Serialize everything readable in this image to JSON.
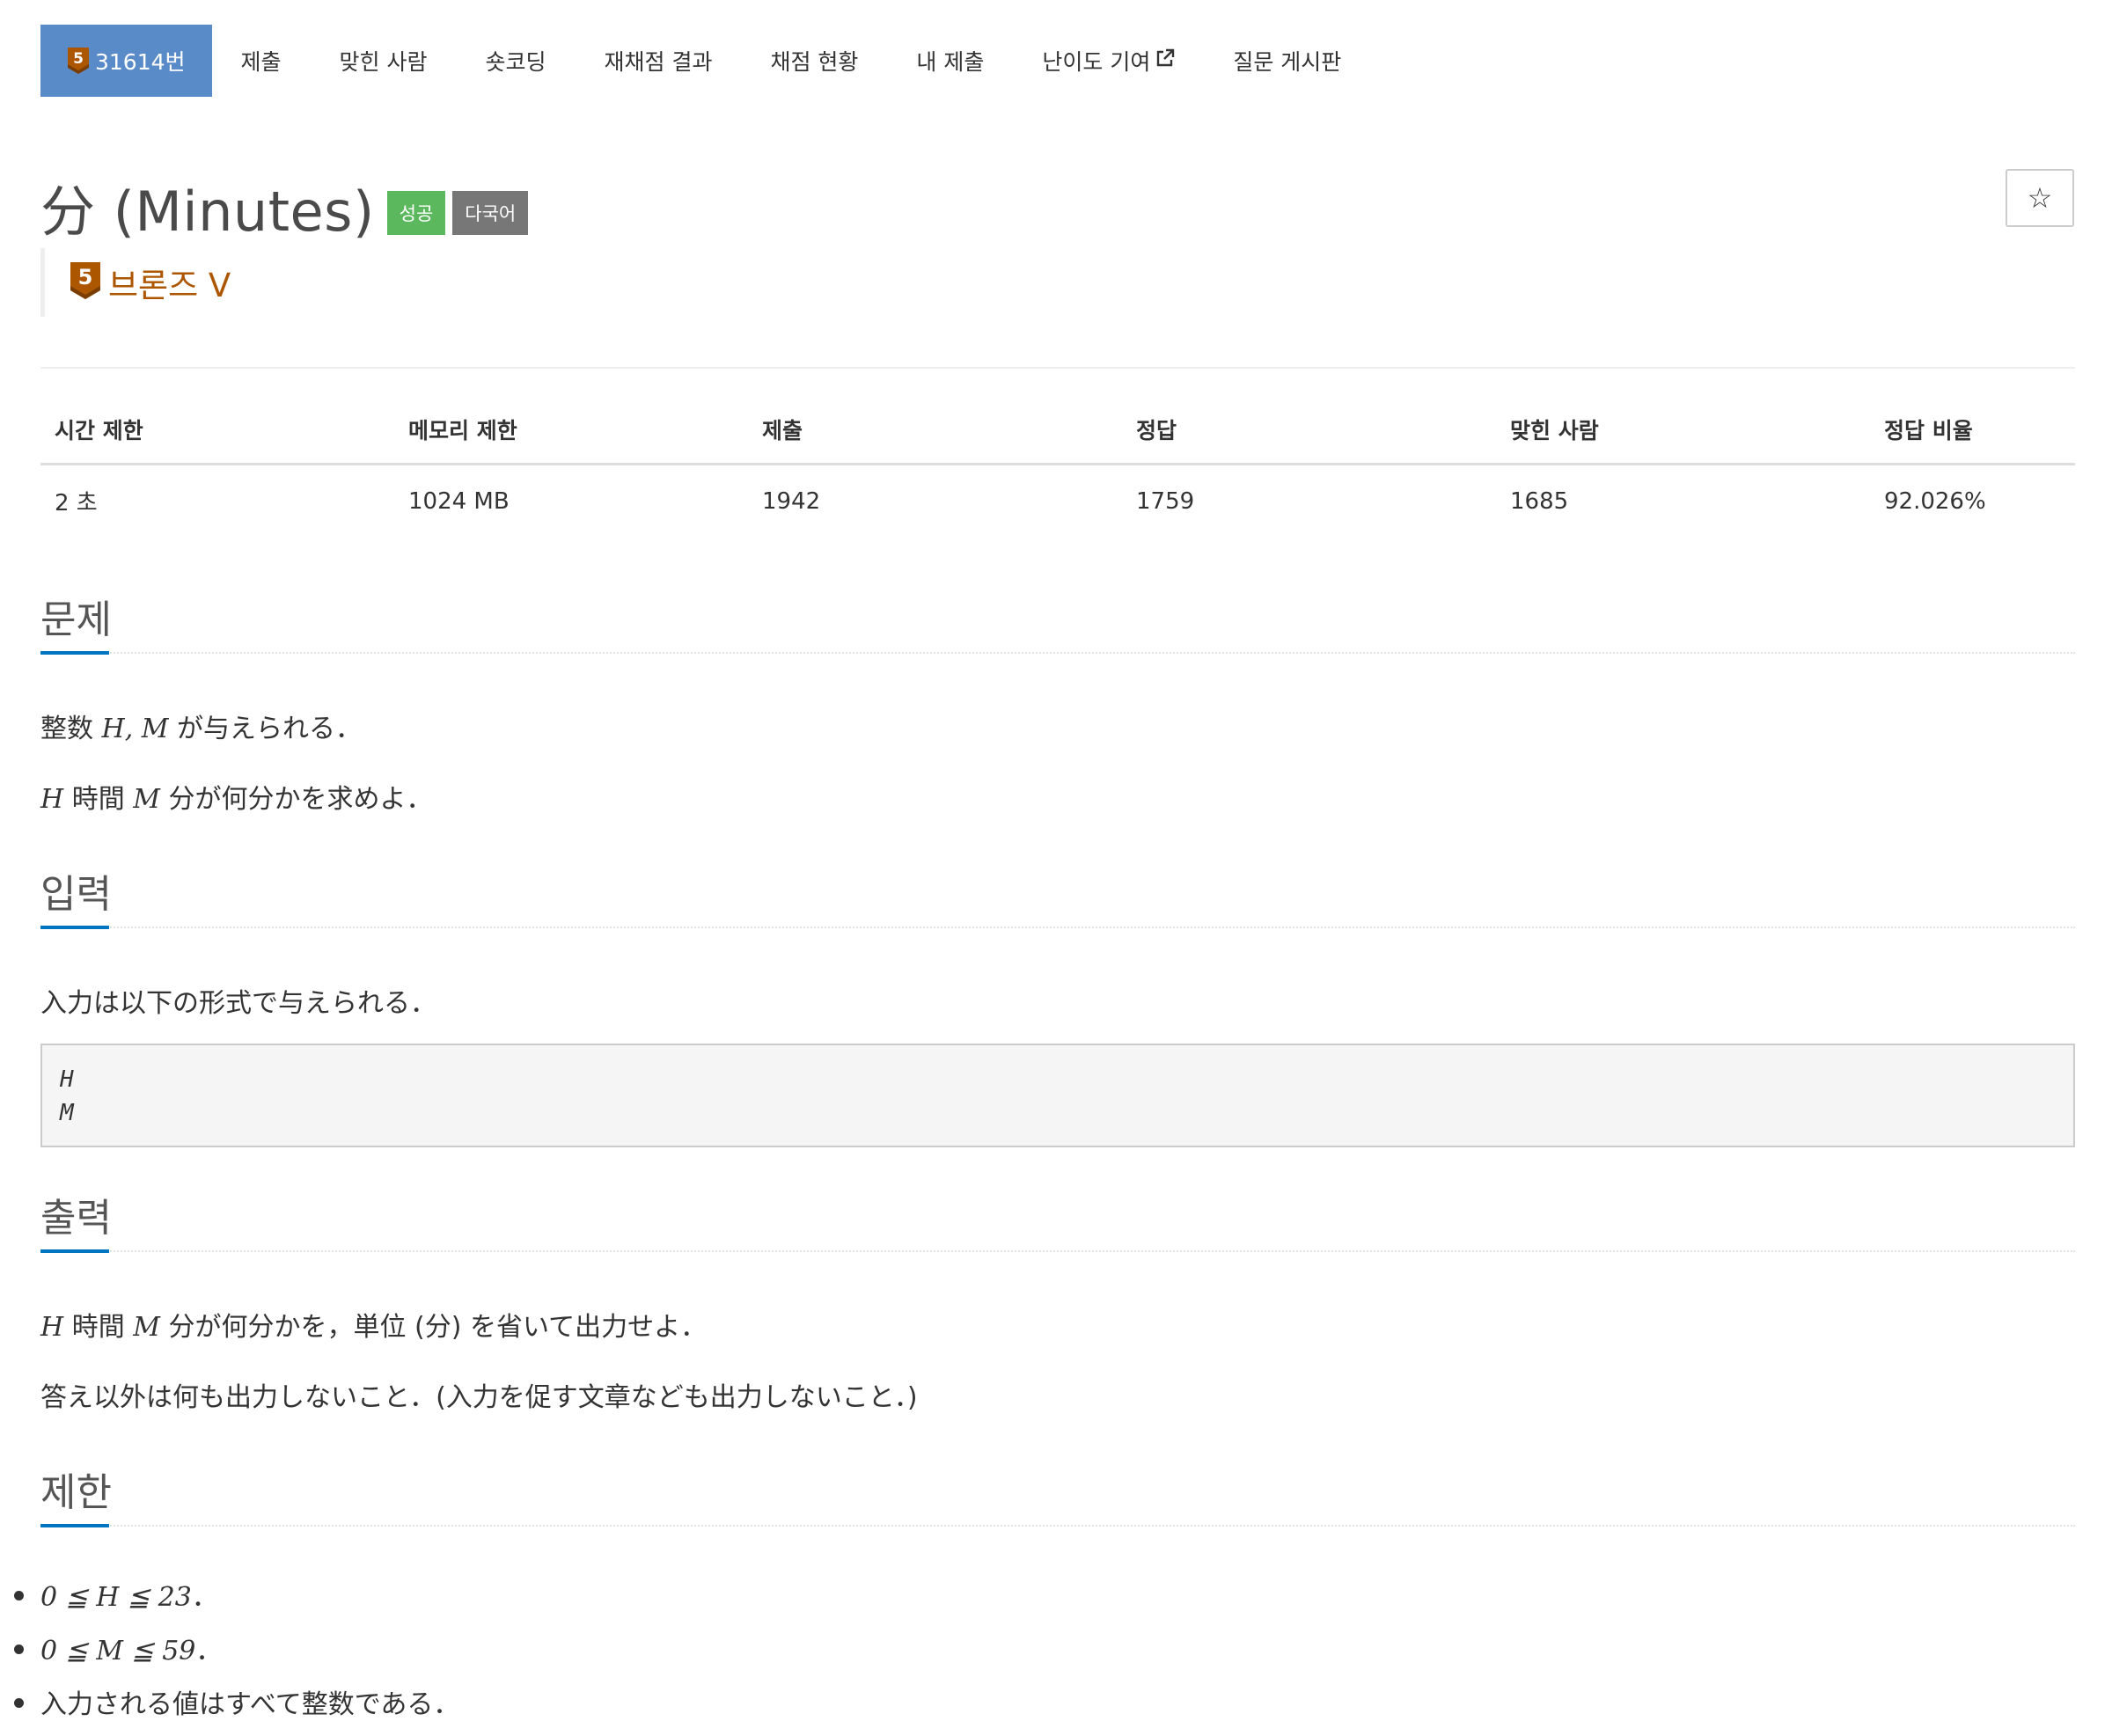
{
  "nav": {
    "tabs": [
      {
        "label": "31614번",
        "tier": "5"
      },
      {
        "label": "제출"
      },
      {
        "label": "맞힌 사람"
      },
      {
        "label": "숏코딩"
      },
      {
        "label": "재채점 결과"
      },
      {
        "label": "채점 현황"
      },
      {
        "label": "내 제출"
      },
      {
        "label": "난이도 기여"
      },
      {
        "label": "질문 게시판"
      }
    ],
    "external_icon": "external-link-icon"
  },
  "problem": {
    "title": "分 (Minutes)",
    "labels": [
      "성공",
      "다국어"
    ],
    "tier_number": "5",
    "tier_name": "브론즈 V",
    "star_glyph": "☆"
  },
  "info": {
    "headers": [
      "시간 제한",
      "메모리 제한",
      "제출",
      "정답",
      "맞힌 사람",
      "정답 비율"
    ],
    "values": [
      "2 초",
      "1024 MB",
      "1942",
      "1759",
      "1685",
      "92.026%"
    ]
  },
  "sections": {
    "problem": {
      "title": "문제",
      "p1": {
        "pre": "整数 ",
        "var": "H, M",
        "post": " が与えられる．"
      },
      "p2": {
        "var1": "H",
        "mid": " 時間 ",
        "var2": "M",
        "post": " 分が何分かを求めよ．"
      }
    },
    "input": {
      "title": "입력",
      "text": "入力は以下の形式で与えられる．",
      "pre_lines": [
        "H",
        "M"
      ]
    },
    "output": {
      "title": "출력",
      "p1": {
        "var1": "H",
        "mid": " 時間 ",
        "var2": "M",
        "post": " 分が何分かを，単位 (分) を省いて出力せよ．"
      },
      "p2": "答え以外は何も出力しないこと．(入力を促す文章なども出力しないこと．)"
    },
    "limits": {
      "title": "제한",
      "items": [
        "0 ≦ H ≦ 23",
        "．",
        "0 ≦ M ≦ 59",
        "．",
        "入力される値はすべて整数である．"
      ]
    }
  },
  "colors": {
    "active_tab": "#5a8bc9",
    "success_label": "#5cb85c",
    "lang_label": "#777777",
    "tier_bronze": "#ad5600",
    "section_underline": "#0076c0"
  }
}
